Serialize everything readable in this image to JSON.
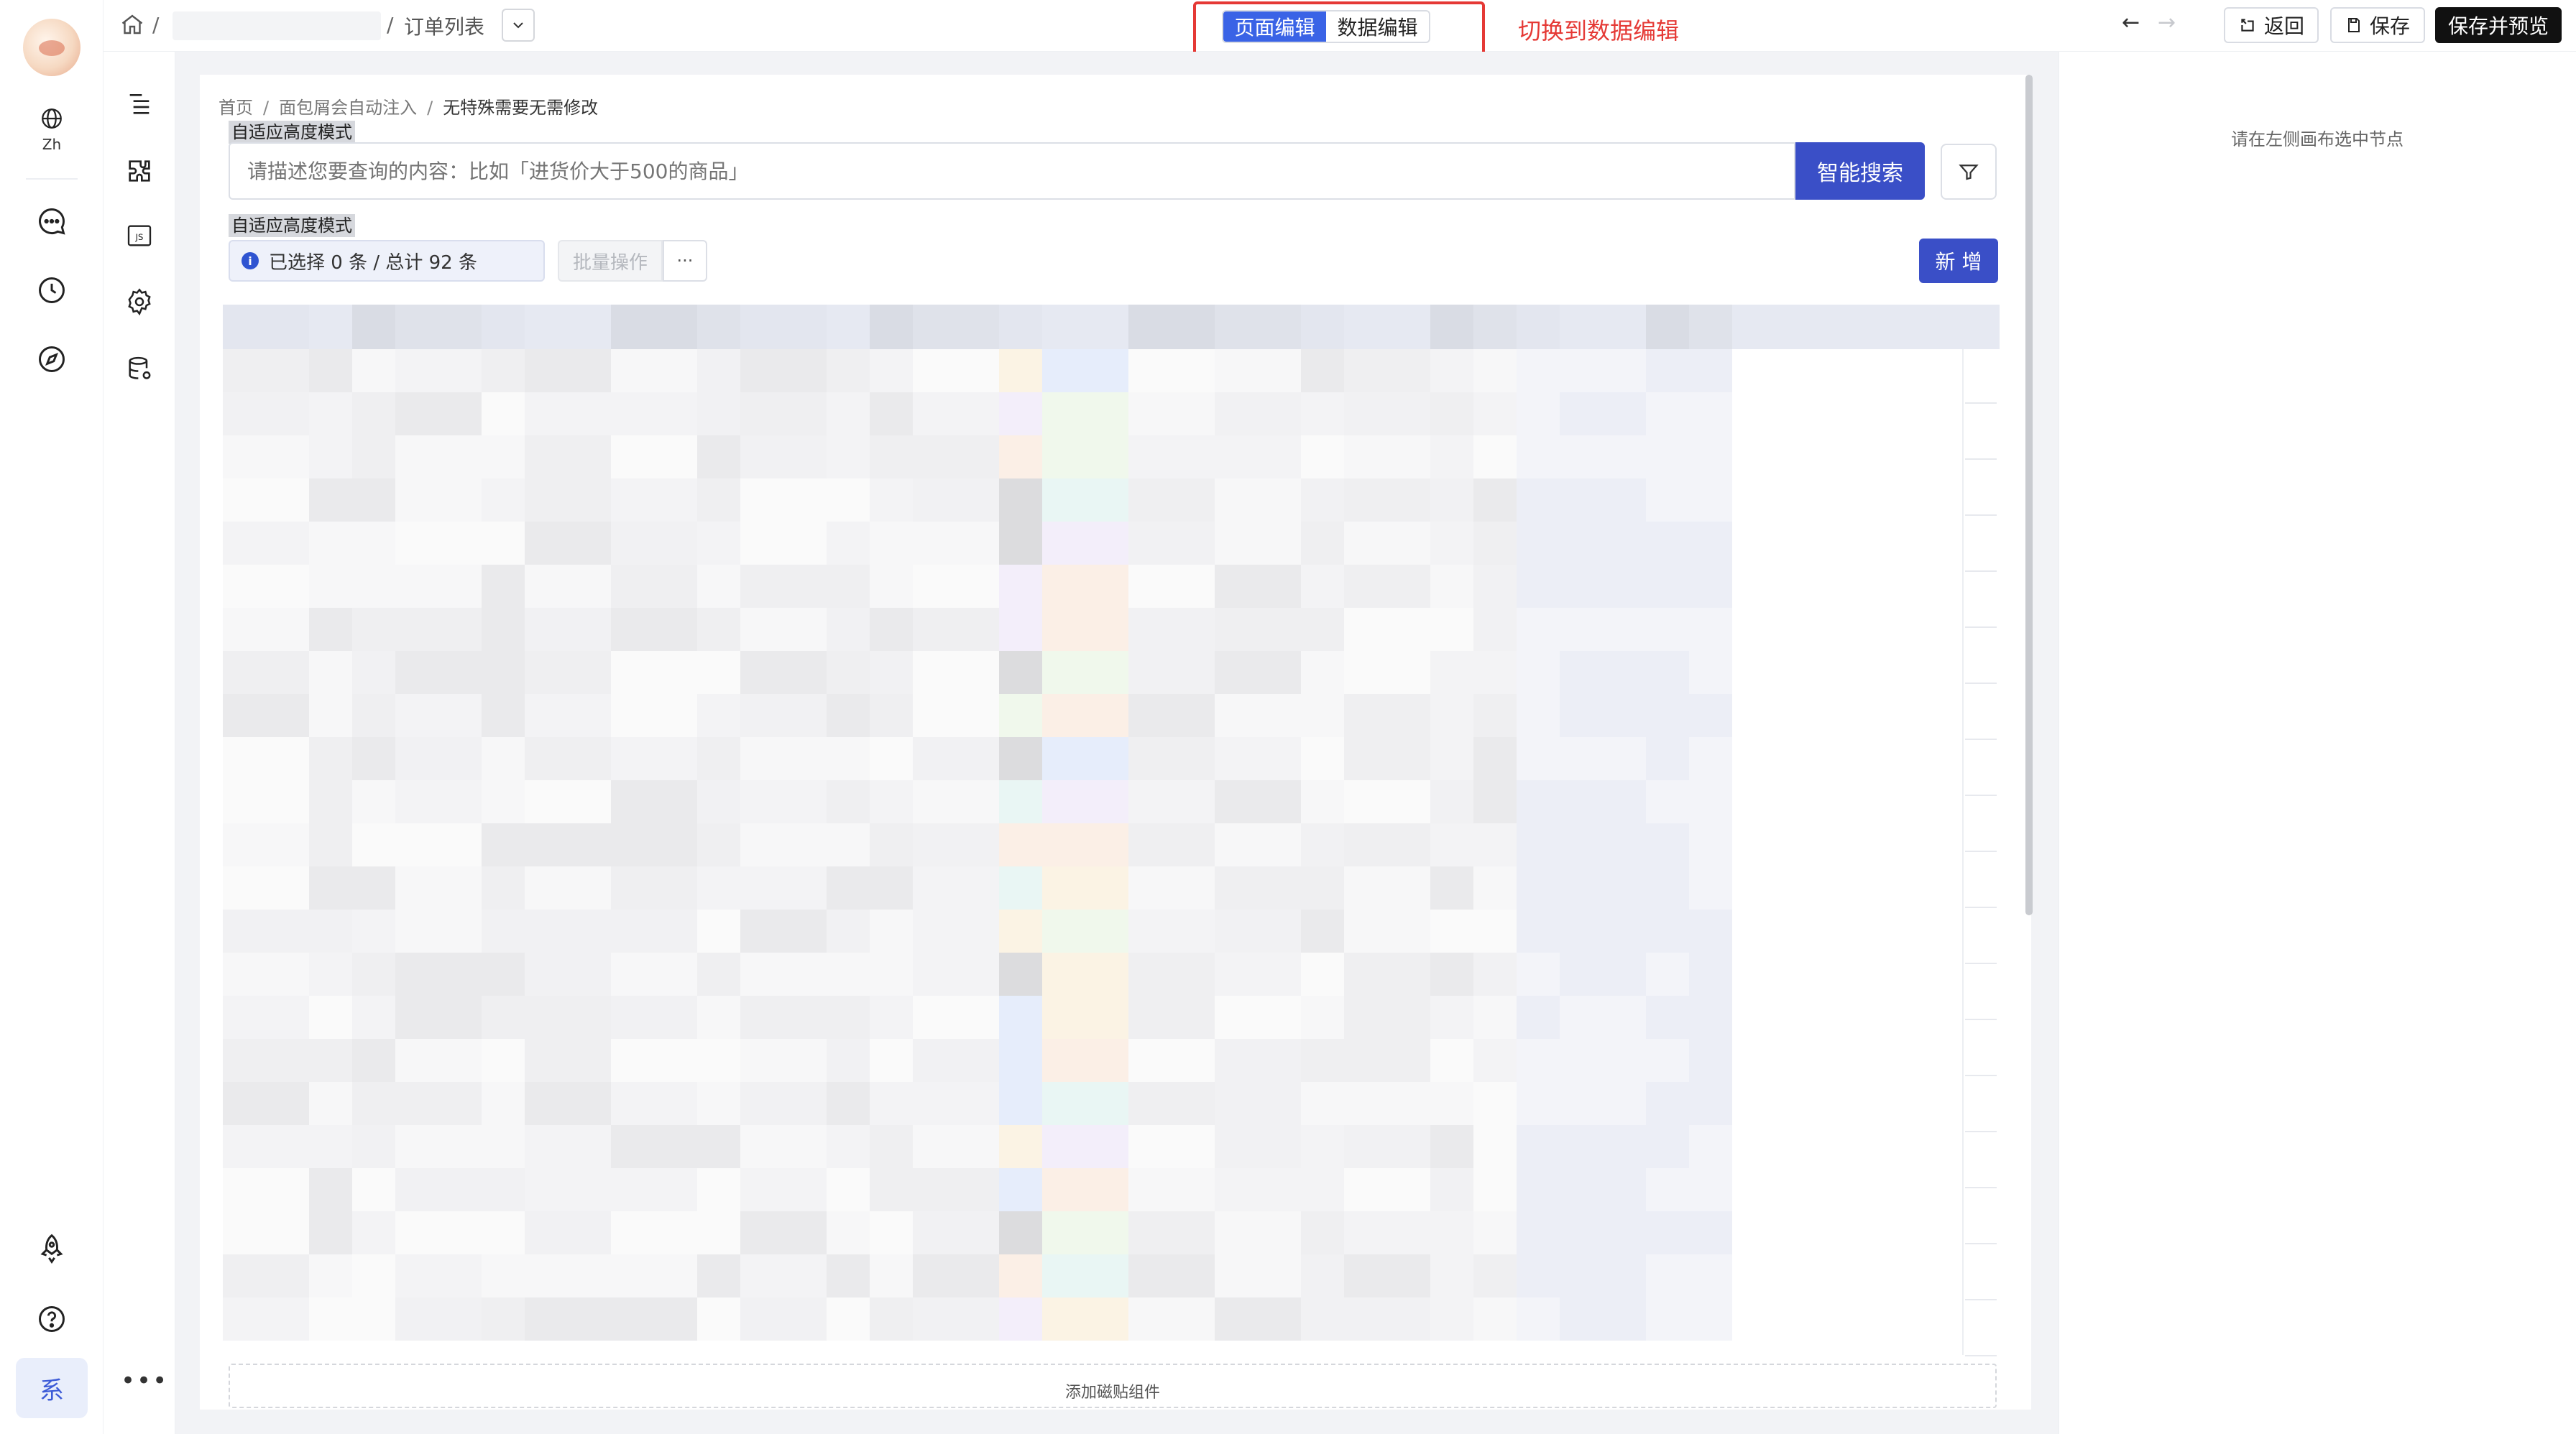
{
  "rail": {
    "lang_label": "Zh",
    "active_item_label": "系"
  },
  "topbar": {
    "breadcrumb_slash": "/",
    "page_name": "订单列表",
    "mode_tabs": [
      "页面编辑",
      "数据编辑"
    ],
    "active_mode": "页面编辑",
    "annotation": "切换到数据编辑",
    "back_label": "返回",
    "save_label": "保存",
    "save_preview_label": "保存并预览"
  },
  "page": {
    "breadcrumb": [
      "首页",
      "面包屑会自动注入",
      "无特殊需要无需修改"
    ],
    "mode_tag": "自适应高度模式",
    "search_placeholder": "请描述您要查询的内容：比如「进货价大于500的商品」",
    "search_button": "智能搜索",
    "selection_text": "已选择 0 条 / 总计 92 条",
    "batch_button": "批量操作",
    "more_button": "···",
    "add_button": "新 增",
    "add_component": "添加磁贴组件"
  },
  "right_panel": {
    "hint": "请在左侧画布选中节点"
  },
  "colors": {
    "primary": "#3a4fc7",
    "mode_active": "#3a63e6",
    "annotation_red": "#e53935",
    "canvas_bg": "#f2f3f6"
  },
  "icons": [
    "avatar",
    "globe-icon",
    "chat-icon",
    "clock-icon",
    "compass-icon",
    "rocket-icon",
    "help-icon",
    "outline-icon",
    "plugin-icon",
    "js-icon",
    "gear-icon",
    "database-icon",
    "home-icon",
    "chevron-down-icon",
    "undo-icon",
    "redo-icon",
    "back-icon",
    "save-icon",
    "filter-icon",
    "info-icon"
  ]
}
